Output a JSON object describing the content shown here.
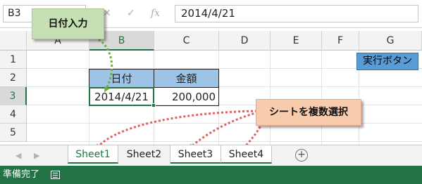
{
  "formula_bar": {
    "name_box": "B3",
    "cancel_icon": "✕",
    "enter_icon": "✓",
    "fx_icon": "fx",
    "formula": "2014/4/21"
  },
  "columns": [
    "A",
    "B",
    "C",
    "D",
    "E",
    "F",
    "G"
  ],
  "selected_column": "B",
  "rows": [
    "1",
    "2",
    "3",
    "4",
    "5"
  ],
  "selected_row": "3",
  "cells": {
    "b2": "日付",
    "c2": "金額",
    "b3": "2014/4/21",
    "c3": "200,000"
  },
  "run_button": {
    "label": "実行ボタン"
  },
  "callouts": {
    "date_input": "日付入力",
    "select_sheets": "シートを複数選択"
  },
  "sheet_tabs": {
    "tabs": [
      "Sheet1",
      "Sheet2",
      "Sheet3",
      "Sheet4"
    ],
    "active": "Sheet1",
    "add_icon": "+"
  },
  "status_bar": {
    "text": "準備完了"
  },
  "colors": {
    "excel_green": "#217346",
    "header_fill": "#9dc3e6",
    "button_fill": "#5b9bd5",
    "callout_green": "#c6e0b4",
    "callout_pink": "#f8cbad",
    "arrow_green": "#70ad47",
    "arrow_red": "#e06060"
  }
}
